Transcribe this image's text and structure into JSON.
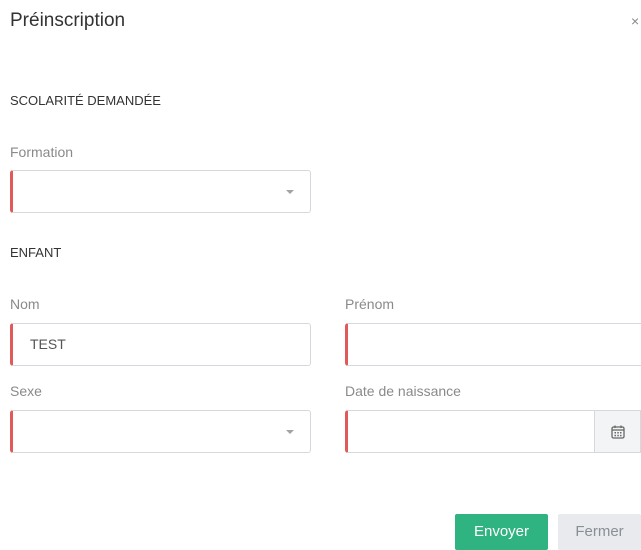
{
  "modal": {
    "title": "Préinscription",
    "close_symbol": "×"
  },
  "sections": {
    "schooling": {
      "title": "SCOLARITÉ DEMANDÉE",
      "formation_label": "Formation",
      "formation_value": ""
    },
    "child": {
      "title": "ENFANT",
      "nom_label": "Nom",
      "nom_value": "TEST",
      "prenom_label": "Prénom",
      "prenom_value": "",
      "sexe_label": "Sexe",
      "sexe_value": "",
      "dob_label": "Date de naissance",
      "dob_value": ""
    }
  },
  "actions": {
    "send_label": "Envoyer",
    "close_label": "Fermer"
  },
  "colors": {
    "required_accent": "#e05a5a",
    "primary": "#2fb380",
    "secondary": "#e8eaed"
  },
  "icons": {
    "calendar": "calendar-icon",
    "dropdown": "chevron-down-icon"
  }
}
